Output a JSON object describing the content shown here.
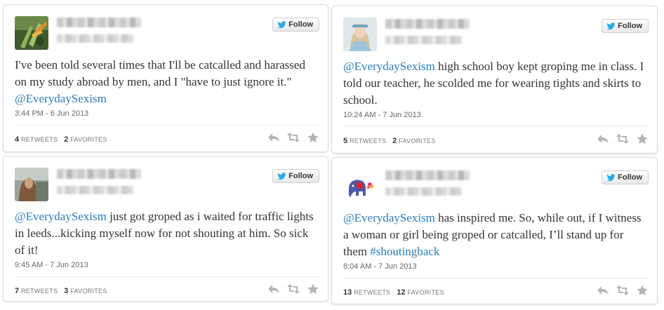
{
  "colors": {
    "link": "#2b7bb9",
    "twitter_bird": "#2aa9e0",
    "action_icon": "#b4b4b4"
  },
  "icons": {
    "follow": "twitter-bird-icon",
    "reply": "reply-icon",
    "retweet": "retweet-icon",
    "favorite": "star-icon"
  },
  "tweets": [
    {
      "follow_label": "Follow",
      "text": [
        "I've been told several times that I'll be catcalled and harassed on my study abroad by men, and I \"have to just ignore it.\" ",
        "@EverydaySexism"
      ],
      "timestamp": "3:44 PM - 6 Jun 2013",
      "retweets": "4",
      "retweets_label": "RETWEETS",
      "favorites": "2",
      "favorites_label": "FAVORITES"
    },
    {
      "follow_label": "Follow",
      "text": [
        "@EverydaySexism",
        " high school boy kept groping me in class. I told our teacher, he scolded me for wearing tights and skirts to school."
      ],
      "timestamp": "10:24 AM - 7 Jun 2013",
      "retweets": "5",
      "retweets_label": "RETWEETS",
      "favorites": "2",
      "favorites_label": "FAVORITES"
    },
    {
      "follow_label": "Follow",
      "text": [
        "@EverydaySexism",
        " just got groped as i waited for traffic lights in leeds...kicking myself now for not shouting at him. So sick of it!"
      ],
      "timestamp": "9:45 AM - 7 Jun 2013",
      "retweets": "7",
      "retweets_label": "RETWEETS",
      "favorites": "3",
      "favorites_label": "FAVORITES"
    },
    {
      "follow_label": "Follow",
      "text": [
        "@EverydaySexism",
        " has inspired me. So, while out, if I witness a woman or girl being groped or catcalled, I’ll stand up for them ",
        "#shoutingback"
      ],
      "timestamp": "8:04 AM - 7 Jun 2013",
      "retweets": "13",
      "retweets_label": "RETWEETS",
      "favorites": "12",
      "favorites_label": "FAVORITES"
    }
  ]
}
